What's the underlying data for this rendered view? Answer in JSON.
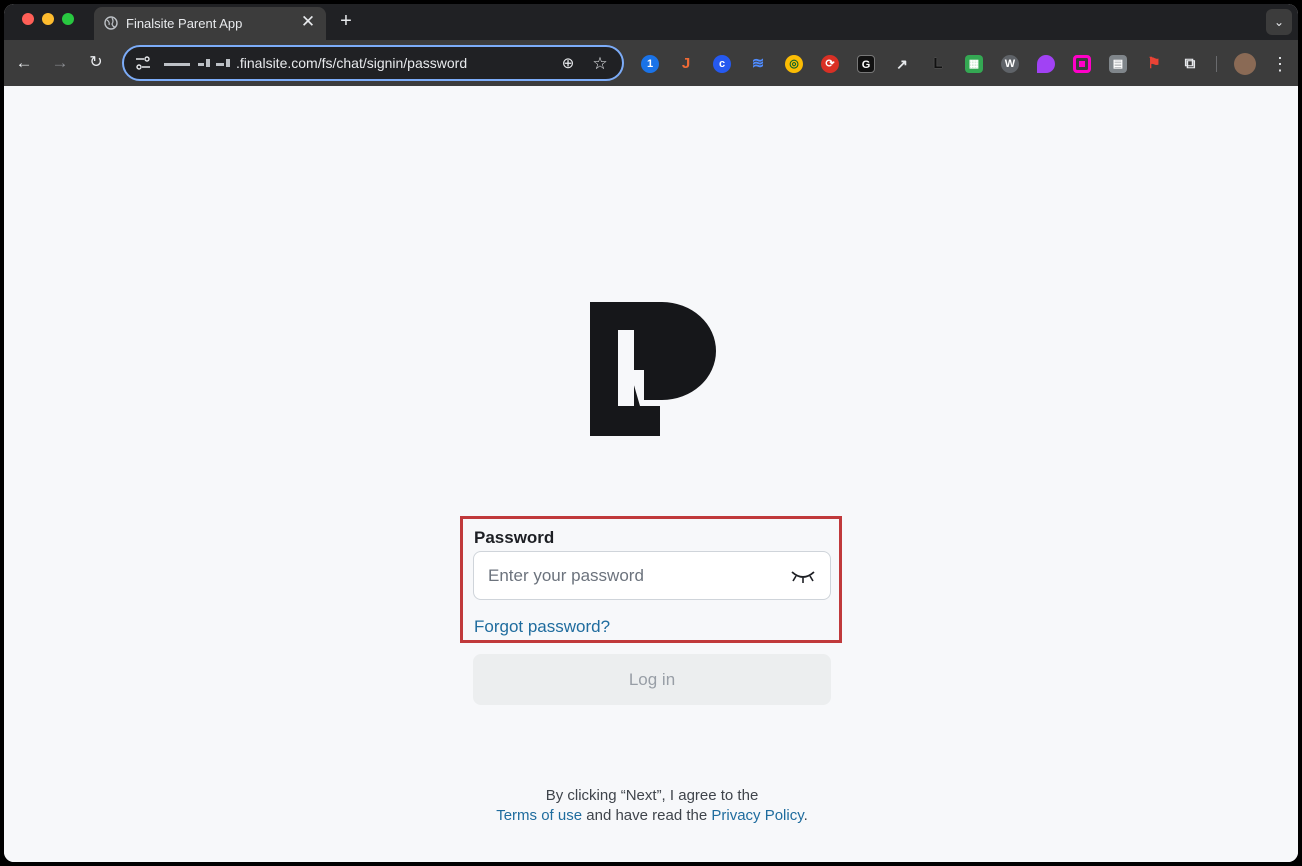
{
  "browser": {
    "tab_title": "Finalsite Parent App",
    "new_tab_label": "+",
    "close_label": "✕",
    "url_domain": ".finalsite.com/fs/chat/signin/password"
  },
  "signin": {
    "password_label": "Password",
    "password_placeholder": "Enter your password",
    "forgot_password": "Forgot password?",
    "login_button": "Log in",
    "consent_line1": "By clicking “Next”, I agree to the",
    "terms_link": "Terms of use",
    "consent_middle": " and have read the ",
    "privacy_link": "Privacy Policy",
    "consent_end": "."
  },
  "colors": {
    "highlight_border": "#c0393b",
    "link": "#1f6c9e",
    "logo": "#16171a"
  },
  "icons": {
    "eye": "eye-closed-icon",
    "zoom": "zoom-icon",
    "bookmark": "star-icon"
  }
}
